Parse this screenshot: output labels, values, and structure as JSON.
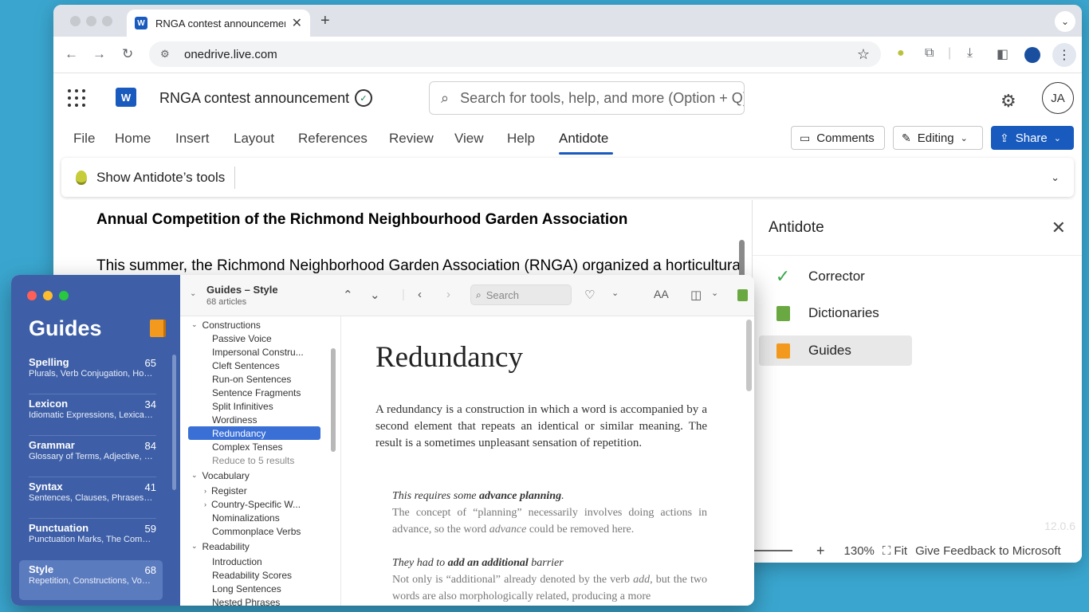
{
  "browser": {
    "tab_title": "RNGA contest announcement",
    "tab_favicon": "W",
    "new_tab_icon": "+",
    "url": "onedrive.live.com"
  },
  "word": {
    "app_icon": "W",
    "doc_title": "RNGA contest announcement",
    "search_placeholder": "Search for tools, help, and more (Option + Q)",
    "avatar_initials": "JA",
    "ribbon_tabs": [
      "File",
      "Home",
      "Insert",
      "Layout",
      "References",
      "Review",
      "View",
      "Help",
      "Antidote"
    ],
    "active_tab": "Antidote",
    "comments_label": "Comments",
    "editing_label": "Editing",
    "share_label": "Share",
    "antidote_tools_label": "Show Antidote’s tools",
    "doc_heading": "Annual Competition of the Richmond Neighbourhood Garden Association",
    "doc_paragraph": "This summer, the Richmond Neighborhood Garden Association (RNGA) organized a horticultural"
  },
  "antidote_panel": {
    "title": "Antidote",
    "items": [
      {
        "label": "Corrector",
        "icon": "check-icon"
      },
      {
        "label": "Dictionaries",
        "icon": "green-book-icon"
      },
      {
        "label": "Guides",
        "icon": "orange-book-icon"
      }
    ],
    "active_item": "Guides",
    "version": "12.0.6",
    "status": {
      "zoom_plus": "+",
      "zoom": "130%",
      "fit": "Fit",
      "feedback": "Give Feedback to Microsoft"
    }
  },
  "guides": {
    "sidebar_title": "Guides",
    "categories": [
      {
        "name": "Spelling",
        "count": "65",
        "desc": "Plurals, Verb Conjugation, Homophones, Capitalization,..."
      },
      {
        "name": "Lexicon",
        "count": "34",
        "desc": "Idiomatic Expressions, Lexical Errors, New Word Formation,..."
      },
      {
        "name": "Grammar",
        "count": "84",
        "desc": "Glossary of Terms, Adjective, Noun, Preposition, Pronoun,..."
      },
      {
        "name": "Syntax",
        "count": "41",
        "desc": "Sentences, Clauses, Phrases, Functions, Questions, Negati..."
      },
      {
        "name": "Punctuation",
        "count": "59",
        "desc": "Punctuation Marks, The Comma, The Hyphen, The D..."
      },
      {
        "name": "Style",
        "count": "68",
        "desc": "Repetition, Constructions, Vocabulary, Readability, Incl..."
      }
    ],
    "active_category": "Style",
    "breadcrumb_title": "Guides – Style",
    "breadcrumb_sub": "68 articles",
    "search_placeholder": "Search",
    "font_size_label": "AA",
    "tree": {
      "constructions": "Constructions",
      "constructions_items": [
        "Passive Voice",
        "Impersonal Constru...",
        "Cleft Sentences",
        "Run-on Sentences",
        "Sentence Fragments",
        "Split Infinitives",
        "Wordiness",
        "Redundancy",
        "Complex Tenses",
        "Reduce to 5 results"
      ],
      "vocabulary": "Vocabulary",
      "vocabulary_items": [
        "Register",
        "Country-Specific W...",
        "Nominalizations",
        "Commonplace Verbs"
      ],
      "readability": "Readability",
      "readability_items": [
        "Introduction",
        "Readability Scores",
        "Long Sentences",
        "Nested Phrases"
      ]
    },
    "selected_item": "Redundancy",
    "article": {
      "title": "Redundancy",
      "body": "A redundancy is a construction in which a word is accompanied by a second element that repeats an identical or similar meaning. The result is a sometimes unpleasant sensation of repetition.",
      "ex1_pre": "This requires some ",
      "ex1_bold": "advance planning",
      "ex1_post": ".",
      "ex1_text_pre": "The concept of “planning” necessarily involves doing actions in advance, so the word ",
      "ex1_text_em": "advance",
      "ex1_text_post": " could be removed here.",
      "ex2_pre": "They had to ",
      "ex2_bold": "add an additional",
      "ex2_post": " barrier",
      "ex2_text_pre": "Not only is “additional” already denoted by the verb ",
      "ex2_text_em": "add",
      "ex2_text_post": ", but the two words are also morphologically related, producing a more"
    }
  },
  "colors": {
    "desktop": "#3aa6cf",
    "word_blue": "#185abd",
    "guides_sidebar": "#3e5fa7",
    "selection": "#3a6fd6"
  }
}
